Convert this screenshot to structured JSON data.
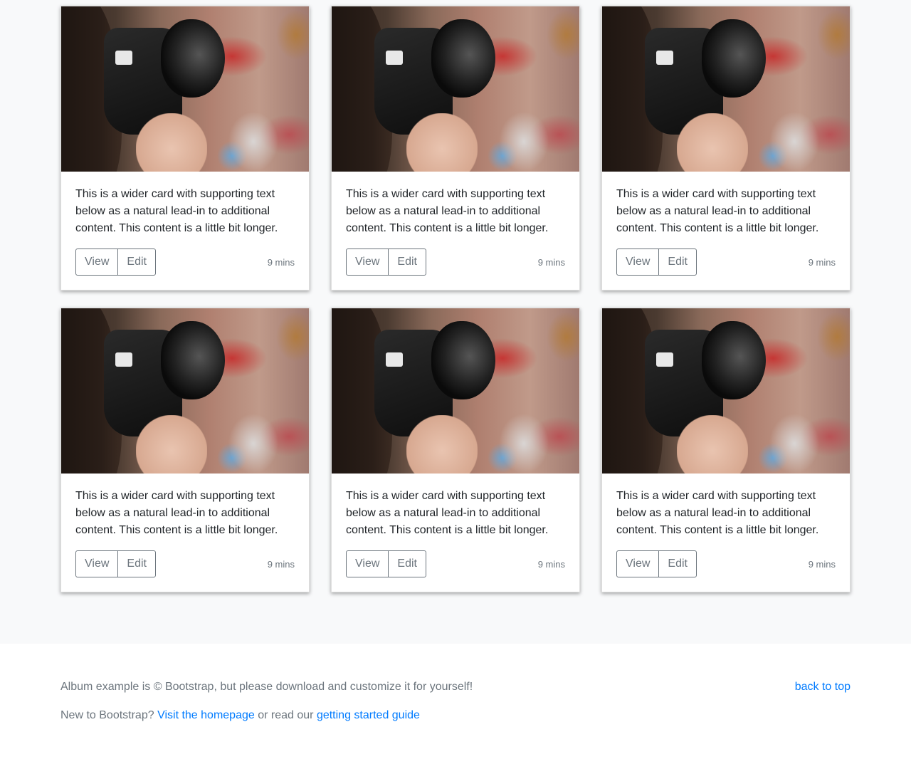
{
  "cards": [
    {
      "text": "This is a wider card with supporting text below as a natural lead-in to additional content. This content is a little bit longer.",
      "view_label": "View",
      "edit_label": "Edit",
      "time": "9 mins"
    },
    {
      "text": "This is a wider card with supporting text below as a natural lead-in to additional content. This content is a little bit longer.",
      "view_label": "View",
      "edit_label": "Edit",
      "time": "9 mins"
    },
    {
      "text": "This is a wider card with supporting text below as a natural lead-in to additional content. This content is a little bit longer.",
      "view_label": "View",
      "edit_label": "Edit",
      "time": "9 mins"
    },
    {
      "text": "This is a wider card with supporting text below as a natural lead-in to additional content. This content is a little bit longer.",
      "view_label": "View",
      "edit_label": "Edit",
      "time": "9 mins"
    },
    {
      "text": "This is a wider card with supporting text below as a natural lead-in to additional content. This content is a little bit longer.",
      "view_label": "View",
      "edit_label": "Edit",
      "time": "9 mins"
    },
    {
      "text": "This is a wider card with supporting text below as a natural lead-in to additional content. This content is a little bit longer.",
      "view_label": "View",
      "edit_label": "Edit",
      "time": "9 mins"
    }
  ],
  "footer": {
    "copyright": "Album example is © Bootstrap, but please download and customize it for yourself!",
    "back_to_top": "back to top",
    "new_prefix": "New to Bootstrap?",
    "homepage_link": "Visit the homepage",
    "middle_text": "or read our",
    "guide_link": "getting started guide"
  },
  "colors": {
    "link": "#007bff",
    "muted": "#6c757d",
    "album_bg": "#f8f9fa"
  }
}
